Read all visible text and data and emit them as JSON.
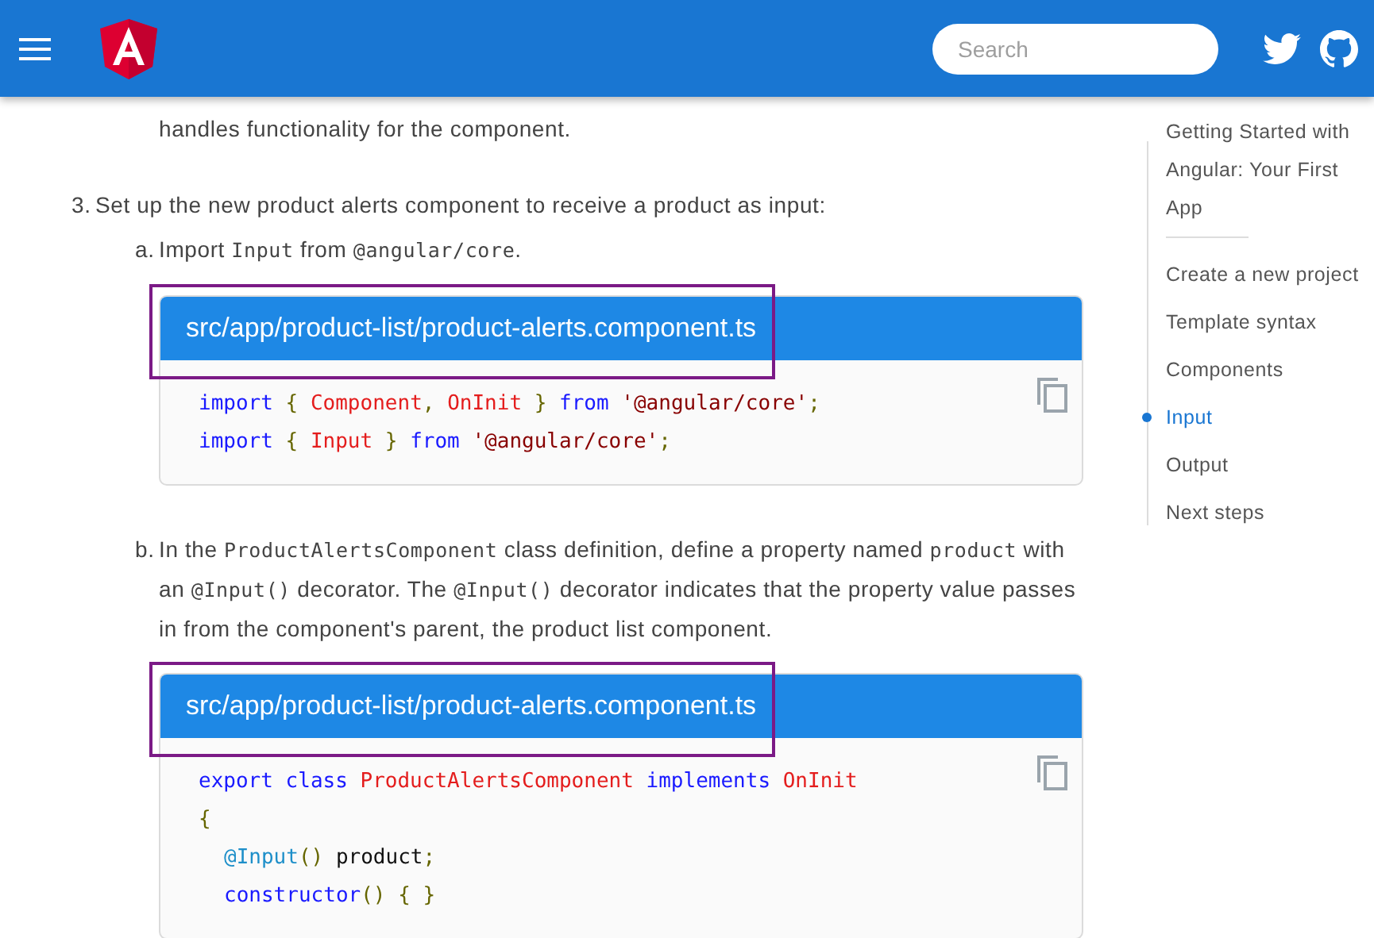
{
  "header": {
    "search": {
      "placeholder": "Search"
    }
  },
  "content": [
    {
      "kind": "continuation",
      "parts": [
        {
          "kind": "text",
          "text": "handles functionality for the component."
        }
      ]
    },
    {
      "kind": "step",
      "marker": "3.",
      "parts": [
        {
          "kind": "text",
          "text": "Set up the new product alerts component to receive a product as input:"
        }
      ]
    },
    {
      "kind": "substep",
      "marker": "a.",
      "parts": [
        {
          "kind": "text",
          "text": "Import "
        },
        {
          "kind": "code",
          "text": "Input"
        },
        {
          "kind": "text",
          "text": " from "
        },
        {
          "kind": "code",
          "text": "@angular/core"
        },
        {
          "kind": "text",
          "text": "."
        }
      ]
    },
    {
      "kind": "codeblock",
      "highlighted": true,
      "filename": "src/app/product-list/product-alerts.component.ts",
      "lines": [
        {
          "indented": false,
          "tokens": [
            {
              "kind": "keyword",
              "text": "import"
            },
            {
              "kind": "punct",
              "text": " { "
            },
            {
              "kind": "type",
              "text": "Component"
            },
            {
              "kind": "punct",
              "text": ", "
            },
            {
              "kind": "type",
              "text": "OnInit"
            },
            {
              "kind": "punct",
              "text": " } "
            },
            {
              "kind": "keyword",
              "text": "from "
            },
            {
              "kind": "string",
              "text": "'@angular/core'"
            },
            {
              "kind": "punct",
              "text": ";"
            }
          ]
        },
        {
          "indented": false,
          "tokens": [
            {
              "kind": "keyword",
              "text": "import"
            },
            {
              "kind": "punct",
              "text": " { "
            },
            {
              "kind": "type",
              "text": "Input"
            },
            {
              "kind": "punct",
              "text": " } "
            },
            {
              "kind": "keyword",
              "text": "from "
            },
            {
              "kind": "string",
              "text": "'@angular/core'"
            },
            {
              "kind": "punct",
              "text": ";"
            }
          ]
        }
      ]
    },
    {
      "kind": "substep",
      "marker": "b.",
      "parts": [
        {
          "kind": "text",
          "text": "In the "
        },
        {
          "kind": "code",
          "text": "ProductAlertsComponent"
        },
        {
          "kind": "text",
          "text": " class definition, define a property named "
        },
        {
          "kind": "code",
          "text": "product"
        },
        {
          "kind": "text",
          "text": " with an "
        },
        {
          "kind": "code",
          "text": "@Input()"
        },
        {
          "kind": "text",
          "text": " decorator. The "
        },
        {
          "kind": "code",
          "text": "@Input()"
        },
        {
          "kind": "text",
          "text": " decorator indicates that the property value passes in from the component's parent, the product list component."
        }
      ]
    },
    {
      "kind": "codeblock",
      "highlighted": true,
      "filename": "src/app/product-list/product-alerts.component.ts",
      "lines": [
        {
          "indented": false,
          "tokens": [
            {
              "kind": "keyword",
              "text": "export class "
            },
            {
              "kind": "type",
              "text": "ProductAlertsComponent "
            },
            {
              "kind": "keyword",
              "text": "implements "
            },
            {
              "kind": "type",
              "text": "OnInit"
            }
          ]
        },
        {
          "indented": false,
          "tokens": [
            {
              "kind": "punct",
              "text": "{"
            }
          ]
        },
        {
          "indented": true,
          "tokens": [
            {
              "kind": "decorator",
              "text": "@Input"
            },
            {
              "kind": "punct",
              "text": "()"
            },
            {
              "kind": "plain",
              "text": " product"
            },
            {
              "kind": "punct",
              "text": ";"
            }
          ]
        },
        {
          "indented": true,
          "tokens": [
            {
              "kind": "keyword",
              "text": "constructor"
            },
            {
              "kind": "punct",
              "text": "() { }"
            }
          ]
        }
      ]
    }
  ],
  "toc": {
    "title": "Getting Started with Angular: Your First App",
    "items": [
      {
        "label": "Create a new project",
        "selected": false
      },
      {
        "label": "Template syntax",
        "selected": false
      },
      {
        "label": "Components",
        "selected": false
      },
      {
        "label": "Input",
        "selected": true
      },
      {
        "label": "Output",
        "selected": false
      },
      {
        "label": "Next steps",
        "selected": false
      }
    ]
  }
}
